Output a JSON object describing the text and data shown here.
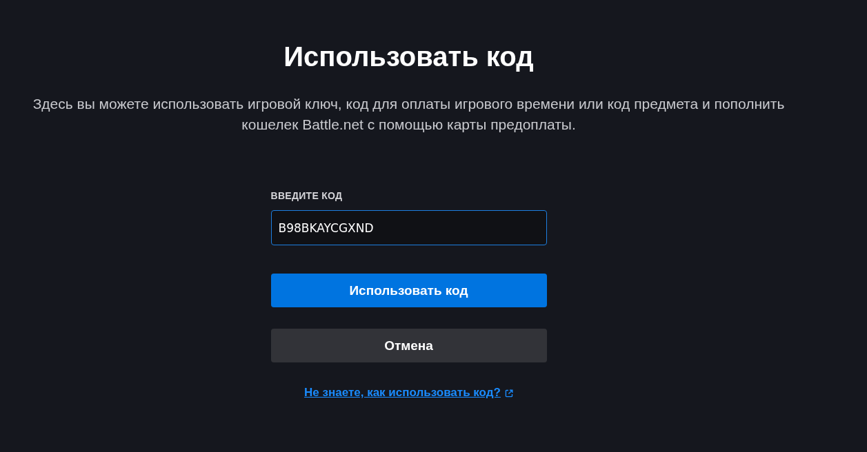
{
  "title": "Использовать код",
  "description": "Здесь вы можете использовать игровой ключ, код для оплаты игрового времени или код предмета и пополнить кошелек Battle.net с помощью карты предоплаты.",
  "form": {
    "label": "ВВЕДИТЕ КОД",
    "code_field": {
      "value": "B98BKAYCGXND",
      "focused": true
    },
    "buttons": [
      {
        "label": "Использовать код",
        "kind": "primary"
      },
      {
        "label": "Отмена",
        "kind": "secondary"
      }
    ],
    "help_link": {
      "label": "Не знаете, как использовать код?",
      "external": true
    }
  }
}
